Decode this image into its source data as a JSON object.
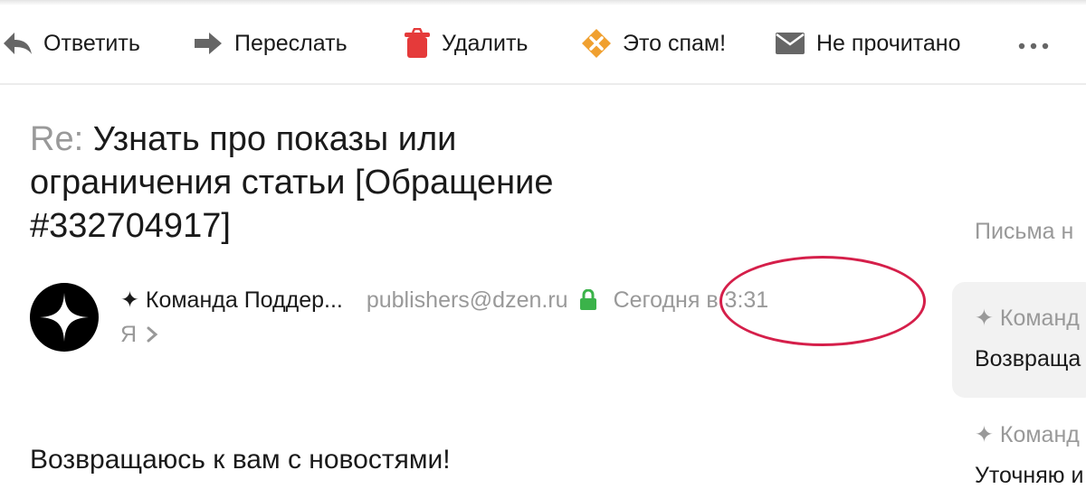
{
  "toolbar": {
    "reply": {
      "label": "Ответить",
      "icon": "reply-arrow-icon"
    },
    "forward": {
      "label": "Переслать",
      "icon": "forward-arrow-icon"
    },
    "delete": {
      "label": "Удалить",
      "icon": "trash-icon",
      "color": "#e53a3a"
    },
    "spam": {
      "label": "Это спам!",
      "icon": "spam-x-icon",
      "color": "#f0a030"
    },
    "unread": {
      "label": "Не прочитано",
      "icon": "envelope-icon"
    },
    "more": {
      "icon": "more-dots-icon"
    }
  },
  "message": {
    "subject_prefix": "Re:",
    "subject": "Узнать про показы или ограничения статьи [Обращение #332704917]",
    "sender_name": "✦ Команда Поддер...",
    "sender_email": "publishers@dzen.ru",
    "date": "Сегодня в 3:31",
    "recipient": "Я",
    "body_first_line": "Возвращаюсь к вам с новостями!"
  },
  "thread": {
    "heading": "Письма н",
    "items": [
      {
        "sender": "✦ Команд",
        "snippet": "Возвраща"
      },
      {
        "sender": "✦ Команд",
        "snippet": "Уточняю и"
      }
    ]
  },
  "colors": {
    "annotation": "#d51f4a",
    "lock": "#3bb34a",
    "muted_text": "#999999"
  }
}
